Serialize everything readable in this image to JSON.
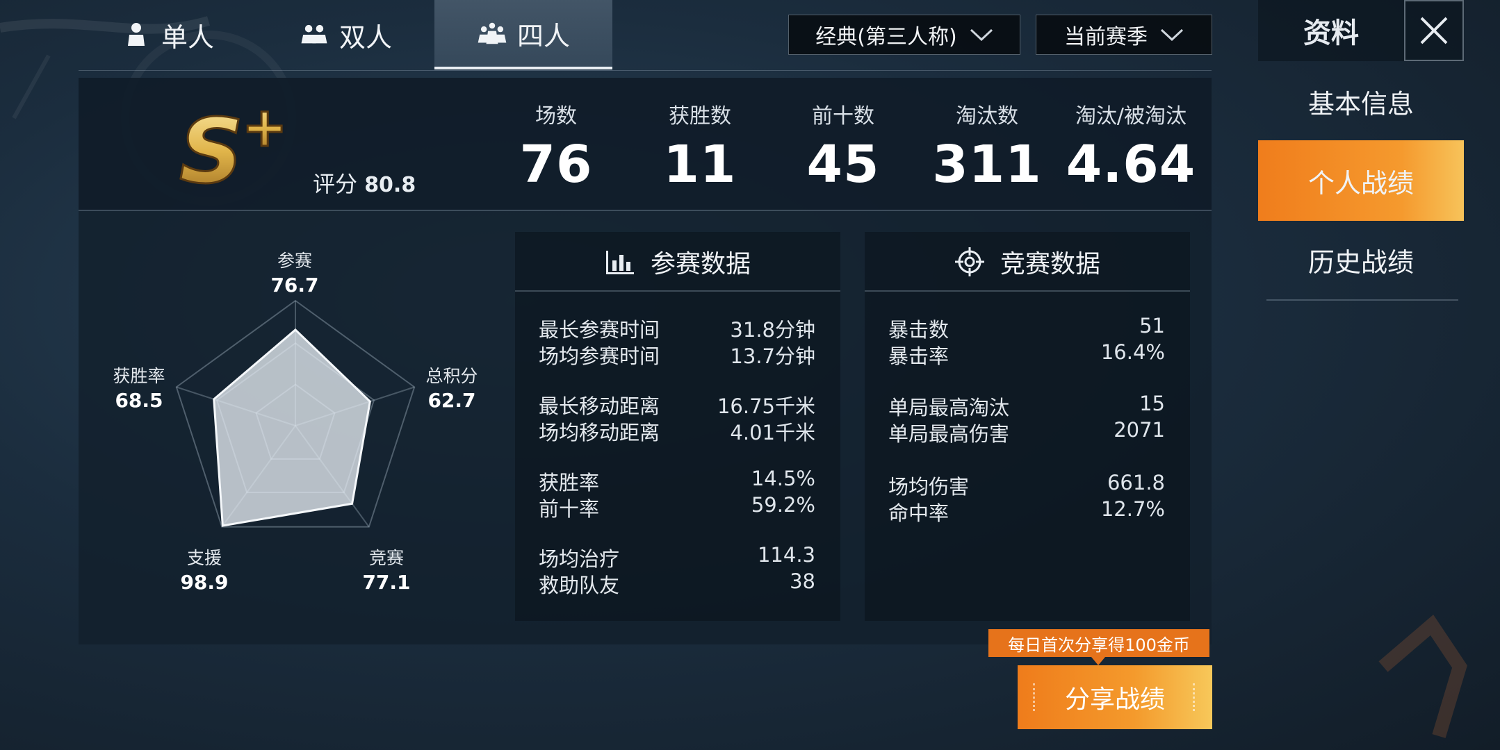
{
  "tabs": [
    {
      "label": "单人",
      "active": false,
      "icon": "single-player-icon"
    },
    {
      "label": "双人",
      "active": false,
      "icon": "duo-icon"
    },
    {
      "label": "四人",
      "active": true,
      "icon": "squad-icon"
    }
  ],
  "dropdowns": {
    "mode": "经典(第三人称)",
    "season": "当前赛季"
  },
  "sidebar": {
    "title": "资料",
    "items": [
      {
        "label": "基本信息",
        "active": false
      },
      {
        "label": "个人战绩",
        "active": true
      },
      {
        "label": "历史战绩",
        "active": false
      }
    ]
  },
  "rank": {
    "badge": "S+",
    "score_label": "评分",
    "score": "80.8"
  },
  "stats": [
    {
      "label": "场数",
      "value": "76"
    },
    {
      "label": "获胜数",
      "value": "11"
    },
    {
      "label": "前十数",
      "value": "45"
    },
    {
      "label": "淘汰数",
      "value": "311"
    },
    {
      "label": "淘汰/被淘汰",
      "value": "4.64"
    }
  ],
  "radar": {
    "axes": [
      {
        "name": "参赛",
        "value": "76.7"
      },
      {
        "name": "总积分",
        "value": "62.7"
      },
      {
        "name": "竞赛",
        "value": "77.1"
      },
      {
        "name": "支援",
        "value": "98.9"
      },
      {
        "name": "获胜率",
        "value": "68.5"
      }
    ]
  },
  "participation": {
    "title": "参赛数据",
    "rows": [
      {
        "label": "最长参赛时间",
        "value": "31.8分钟"
      },
      {
        "label": "场均参赛时间",
        "value": "13.7分钟"
      },
      {
        "label": "最长移动距离",
        "value": "16.75千米"
      },
      {
        "label": "场均移动距离",
        "value": "4.01千米"
      },
      {
        "label": "获胜率",
        "value": "14.5%"
      },
      {
        "label": "前十率",
        "value": "59.2%"
      },
      {
        "label": "场均治疗",
        "value": "114.3"
      },
      {
        "label": "救助队友",
        "value": "38"
      }
    ]
  },
  "competition": {
    "title": "竞赛数据",
    "rows": [
      {
        "label": "暴击数",
        "value": "51"
      },
      {
        "label": "暴击率",
        "value": "16.4%"
      },
      {
        "label": "单局最高淘汰",
        "value": "15"
      },
      {
        "label": "单局最高伤害",
        "value": "2071"
      },
      {
        "label": "场均伤害",
        "value": "661.8"
      },
      {
        "label": "命中率",
        "value": "12.7%"
      }
    ]
  },
  "share": {
    "tip": "每日首次分享得100金币",
    "button": "分享战绩"
  },
  "colors": {
    "accent_orange": "#f07d1c",
    "badge_gold": "#e0b44a"
  }
}
